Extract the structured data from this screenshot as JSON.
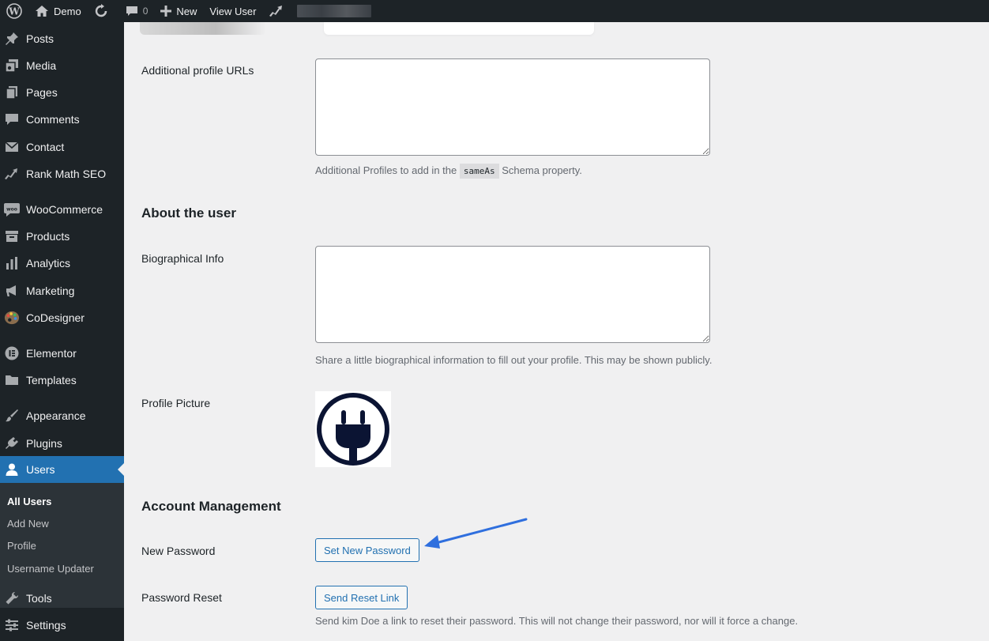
{
  "adminbar": {
    "site_name": "Demo",
    "comments_count": "0",
    "new_label": "New",
    "view_user_label": "View User"
  },
  "sidebar": {
    "items": [
      {
        "label": "Posts",
        "icon": "pin-icon"
      },
      {
        "label": "Media",
        "icon": "media-icon"
      },
      {
        "label": "Pages",
        "icon": "pages-icon"
      },
      {
        "label": "Comments",
        "icon": "comment-icon"
      },
      {
        "label": "Contact",
        "icon": "mail-icon"
      },
      {
        "label": "Rank Math SEO",
        "icon": "rankmath-icon"
      },
      {
        "label": "WooCommerce",
        "icon": "woo-icon"
      },
      {
        "label": "Products",
        "icon": "archive-icon"
      },
      {
        "label": "Analytics",
        "icon": "chart-bar-icon"
      },
      {
        "label": "Marketing",
        "icon": "megaphone-icon"
      },
      {
        "label": "CoDesigner",
        "icon": "palette-icon"
      },
      {
        "label": "Elementor",
        "icon": "elementor-icon"
      },
      {
        "label": "Templates",
        "icon": "folder-icon"
      },
      {
        "label": "Appearance",
        "icon": "brush-icon"
      },
      {
        "label": "Plugins",
        "icon": "plugin-icon"
      },
      {
        "label": "Users",
        "icon": "user-icon"
      },
      {
        "label": "Tools",
        "icon": "wrench-icon"
      },
      {
        "label": "Settings",
        "icon": "settings-icon"
      }
    ],
    "submenu": [
      "All Users",
      "Add New",
      "Profile",
      "Username Updater"
    ]
  },
  "form": {
    "additional_urls_label": "Additional profile URLs",
    "additional_urls_desc_pre": "Additional Profiles to add in the",
    "additional_urls_desc_code": "sameAs",
    "additional_urls_desc_post": "Schema property.",
    "about_title": "About the user",
    "bio_label": "Biographical Info",
    "bio_desc": "Share a little biographical information to fill out your profile. This may be shown publicly.",
    "profile_picture_label": "Profile Picture",
    "account_title": "Account Management",
    "new_password_label": "New Password",
    "set_password_button": "Set New Password",
    "password_reset_label": "Password Reset",
    "send_reset_button": "Send Reset Link",
    "reset_desc": "Send kim Doe a link to reset their password. This will not change their password, nor will it force a change."
  },
  "colors": {
    "accent": "#2271b1",
    "admin_bar": "#1d2327",
    "arrow": "#2f6fde"
  }
}
